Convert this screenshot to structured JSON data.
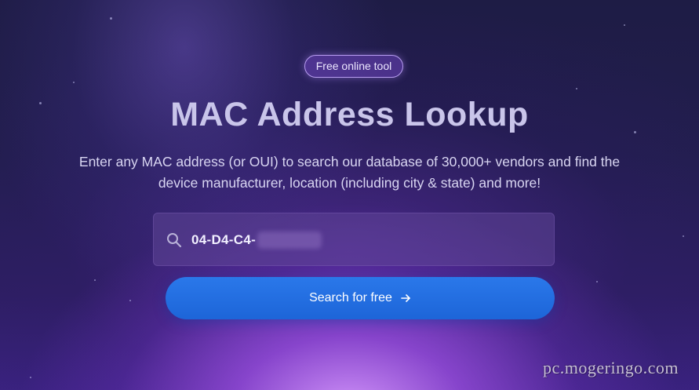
{
  "badge": {
    "label": "Free online tool"
  },
  "hero": {
    "title": "MAC Address Lookup",
    "subtitle_line1": "Enter any MAC address (or OUI) to search our database of 30,000+ vendors and find the",
    "subtitle_line2": "device manufacturer, location (including city & state) and more!"
  },
  "search": {
    "value": "04-D4-C4-",
    "icon": "search-icon",
    "button_label": "Search for free",
    "button_icon": "arrow-right-icon"
  },
  "watermark": {
    "text": "pc.mogeringo.com"
  },
  "colors": {
    "accent_button": "#1d65d8",
    "badge_border": "#b79cf0",
    "background_dark": "#1e1c45",
    "background_glow": "#d696ff"
  }
}
